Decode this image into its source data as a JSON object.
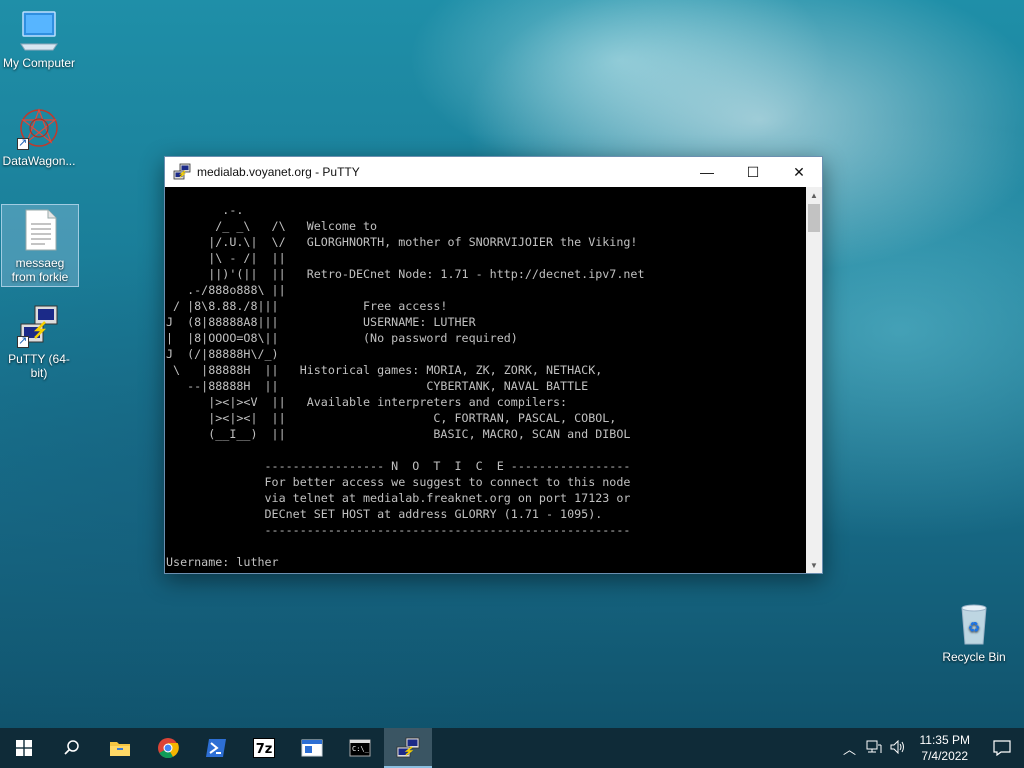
{
  "desktop": {
    "icons": [
      {
        "label": "My Computer"
      },
      {
        "label": "DataWagon..."
      },
      {
        "label": "messaeg from forkie"
      },
      {
        "label": "PuTTY (64-bit)"
      },
      {
        "label": "Recycle Bin"
      }
    ]
  },
  "window": {
    "title": "medialab.voyanet.org - PuTTY",
    "minimize": "—",
    "maximize": "☐",
    "close": "✕",
    "terminal_lines": [
      "        .-.",
      "       /_ _\\   /\\   Welcome to",
      "      |/.U.\\|  \\/   GLORGHNORTH, mother of SNORRVIJOIER the Viking!",
      "      |\\ - /|  ||",
      "      ||)'(||  ||   Retro-DECnet Node: 1.71 - http://decnet.ipv7.net",
      "   .-/888o888\\ ||",
      " / |8\\8.88./8|||            Free access!",
      "J  (8|88888A8|||            USERNAME: LUTHER",
      "|  |8|OOOO=O8\\||            (No password required)",
      "J  (/|88888H\\/_)",
      " \\   |88888H  ||   Historical games: MORIA, ZK, ZORK, NETHACK,",
      "   --|88888H  ||                     CYBERTANK, NAVAL BATTLE",
      "      |><|><V  ||   Available interpreters and compilers:",
      "      |><|><|  ||                     C, FORTRAN, PASCAL, COBOL,",
      "      (__I__)  ||                     BASIC, MACRO, SCAN and DIBOL",
      "",
      "              ----------------- N  O  T  I  C  E -----------------",
      "              For better access we suggest to connect to this node",
      "              via telnet at medialab.freaknet.org on port 17123 or",
      "              DECnet SET HOST at address GLORRY (1.71 - 1095).",
      "              ----------------------------------------------------",
      "",
      "Username: luther"
    ]
  },
  "taskbar": {
    "clock_time": "11:35 PM",
    "clock_date": "7/4/2022"
  }
}
